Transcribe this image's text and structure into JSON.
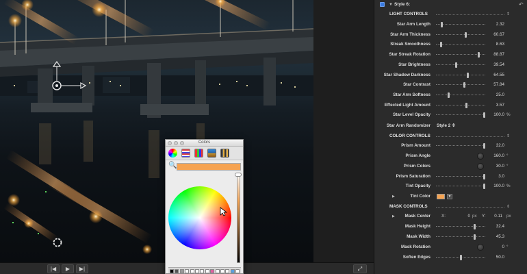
{
  "viewer": {
    "transport": {
      "prev_glyph": "|◀",
      "play_glyph": "▶",
      "next_glyph": "▶|",
      "fullscreen_glyph": "⤢"
    }
  },
  "colors_window": {
    "title": "Colors",
    "selected_color": "#f6a351",
    "tools": [
      "color-wheel-icon",
      "color-sliders-icon",
      "color-palettes-icon",
      "image-palettes-icon",
      "pencils-icon"
    ],
    "palette": [
      "#000000",
      "#555555",
      "#999999",
      "#ffffff",
      "#ffffff",
      "#ffffff",
      "#ffffff",
      "#ffffff",
      "#e060a0",
      "#ffffff",
      "#ffffff",
      "#ffffff",
      "#5aa0e0",
      "#ffffff"
    ]
  },
  "panel": {
    "header": {
      "title": "Style 6:",
      "reset_glyph": "↶"
    },
    "sections": {
      "light": "LIGHT CONTROLS",
      "color": "COLOR CONTROLS",
      "mask": "MASK CONTROLS",
      "spin": "⇕"
    },
    "light_controls": [
      {
        "label": "Star Arm Length",
        "value": "2.32",
        "unit": "",
        "pos": 0.1
      },
      {
        "label": "Star Arm Thickness",
        "value": "60.67",
        "unit": "",
        "pos": 0.61
      },
      {
        "label": "Streak Smoothness",
        "value": "8.63",
        "unit": "",
        "pos": 0.09
      },
      {
        "label": "Star Streak Rotation",
        "value": "88.87",
        "unit": "",
        "pos": 0.89
      },
      {
        "label": "Star Brightness",
        "value": "39.54",
        "unit": "",
        "pos": 0.4
      },
      {
        "label": "Star Shadow Darkness",
        "value": "64.55",
        "unit": "",
        "pos": 0.65
      },
      {
        "label": "Star Contrast",
        "value": "57.84",
        "unit": "",
        "pos": 0.58
      },
      {
        "label": "Star Arm Softness",
        "value": "25.0",
        "unit": "",
        "pos": 0.25
      },
      {
        "label": "Effected Light Amount",
        "value": "3.57",
        "unit": "",
        "pos": 0.63
      },
      {
        "label": "Star Level Opacity",
        "value": "100.0",
        "unit": "%",
        "pos": 1.0
      }
    ],
    "randomizer": {
      "label": "Star Arm Randomizer",
      "value": "Style 2 ⇕"
    },
    "color_controls": {
      "prism_amount": {
        "label": "Prism Amount",
        "value": "32.0",
        "pos": 1.0
      },
      "prism_angle": {
        "label": "Prism Angle",
        "value": "160.0",
        "unit": "°"
      },
      "prism_colors": {
        "label": "Prism Colors",
        "value": "30.0",
        "unit": "°"
      },
      "prism_saturation": {
        "label": "Prism Saturation",
        "value": "3.0",
        "pos": 1.0
      },
      "tint_opacity": {
        "label": "Tint Opacity",
        "value": "100.0",
        "unit": "%",
        "pos": 1.0
      },
      "tint_color": {
        "label": "Tint Color",
        "swatch": "#f6a351",
        "disclose": "▶",
        "drop": "▼"
      }
    },
    "mask_controls": {
      "mask_center": {
        "label": "Mask Center",
        "disclose": "▶",
        "x_label": "X:",
        "x": "0",
        "x_unit": "px",
        "y_label": "Y:",
        "y": "0.11",
        "y_unit": "px"
      },
      "mask_height": {
        "label": "Mask Height",
        "value": "32.4",
        "pos": 0.8
      },
      "mask_width": {
        "label": "Mask Width",
        "value": "45.3",
        "pos": 0.8
      },
      "mask_rotation": {
        "label": "Mask Rotation",
        "value": "0",
        "unit": "°"
      },
      "soften_edges": {
        "label": "Soften Edges",
        "value": "50.0",
        "pos": 0.5
      }
    }
  }
}
